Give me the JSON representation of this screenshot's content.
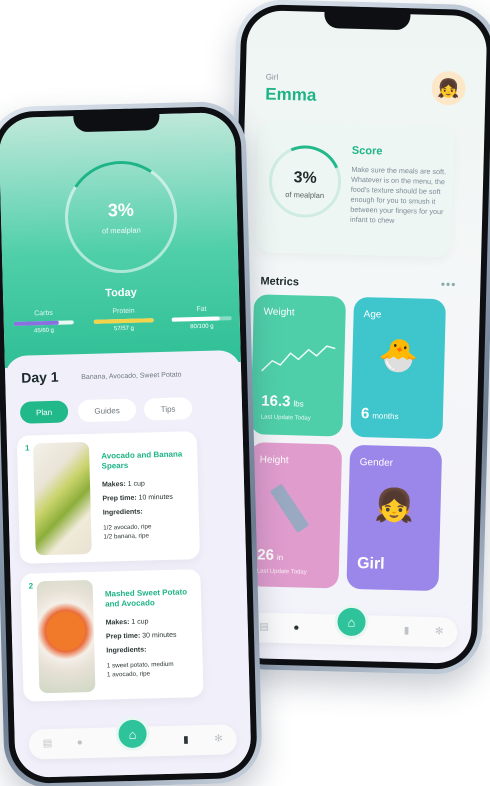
{
  "back_screen": {
    "user": {
      "label": "Girl",
      "name": "Emma",
      "avatar_icon": "girl-face-icon"
    },
    "score_card": {
      "percent": "3%",
      "subtitle": "of mealplan",
      "title": "Score",
      "text": "Make sure the meals are soft. Whatever is on the menu, the food's texture should be soft enough for you to smush it between your fingers for your infant to chew"
    },
    "metrics_title": "Metrics",
    "more_label": "•••",
    "tiles": [
      {
        "label": "Weight",
        "value": "16.3",
        "unit": "lbs",
        "update_prefix": "Last Update",
        "update_value": "Today",
        "color": "#4fcfa9",
        "icon": "line-graph-icon"
      },
      {
        "label": "Age",
        "value": "6",
        "unit": "months",
        "color": "#3fc6cc",
        "icon": "hatching-chick-icon"
      },
      {
        "label": "Height",
        "value": "26",
        "unit": "in",
        "update_prefix": "Last Update",
        "update_value": "Today",
        "color": "#e09ccd",
        "icon": "ruler-icon"
      },
      {
        "label": "Gender",
        "value": "Girl",
        "color": "#9b86ea",
        "icon": "girl-face-icon"
      }
    ],
    "nav": {
      "icons": [
        "chart-icon",
        "person-icon",
        "home-icon",
        "book-icon",
        "gear-icon"
      ]
    }
  },
  "front_screen": {
    "progress": {
      "percent": "3%",
      "subtitle": "of mealplan"
    },
    "today_label": "Today",
    "macros": [
      {
        "name": "Carbs",
        "value": "45/60 g",
        "fill": 0.75,
        "color": "#8a6fe0"
      },
      {
        "name": "Protein",
        "value": "57/57 g",
        "fill": 1.0,
        "color": "#f2d34a"
      },
      {
        "name": "Fat",
        "value": "80/100 g",
        "fill": 0.8,
        "color": "#ffffff"
      }
    ],
    "day": {
      "title": "Day 1",
      "foods": "Banana, Avocado, Sweet Potato"
    },
    "tabs": [
      {
        "label": "Plan",
        "active": true
      },
      {
        "label": "Guides",
        "active": false
      },
      {
        "label": "Tips",
        "active": false
      }
    ],
    "meals": [
      {
        "number": "1",
        "title": "Avocado and Banana Spears",
        "makes_label": "Makes:",
        "makes": "1 cup",
        "prep_label": "Prep time:",
        "prep": "10 minutes",
        "ingredients_label": "Ingredients:",
        "ingredients": [
          "1/2 avocado, ripe",
          "1/2 banana, ripe"
        ],
        "photo": "avocado-banana-photo"
      },
      {
        "number": "2",
        "title": "Mashed Sweet Potato and Avocado",
        "makes_label": "Makes:",
        "makes": "1 cup",
        "prep_label": "Prep time:",
        "prep": "30 minutes",
        "ingredients_label": "Ingredients:",
        "ingredients": [
          "1 sweet potato, medium",
          "1 avocado, ripe"
        ],
        "photo": "sweet-potato-photo"
      }
    ],
    "nav": {
      "icons": [
        "chart-icon",
        "person-icon",
        "home-icon",
        "book-icon",
        "gear-icon"
      ]
    }
  }
}
